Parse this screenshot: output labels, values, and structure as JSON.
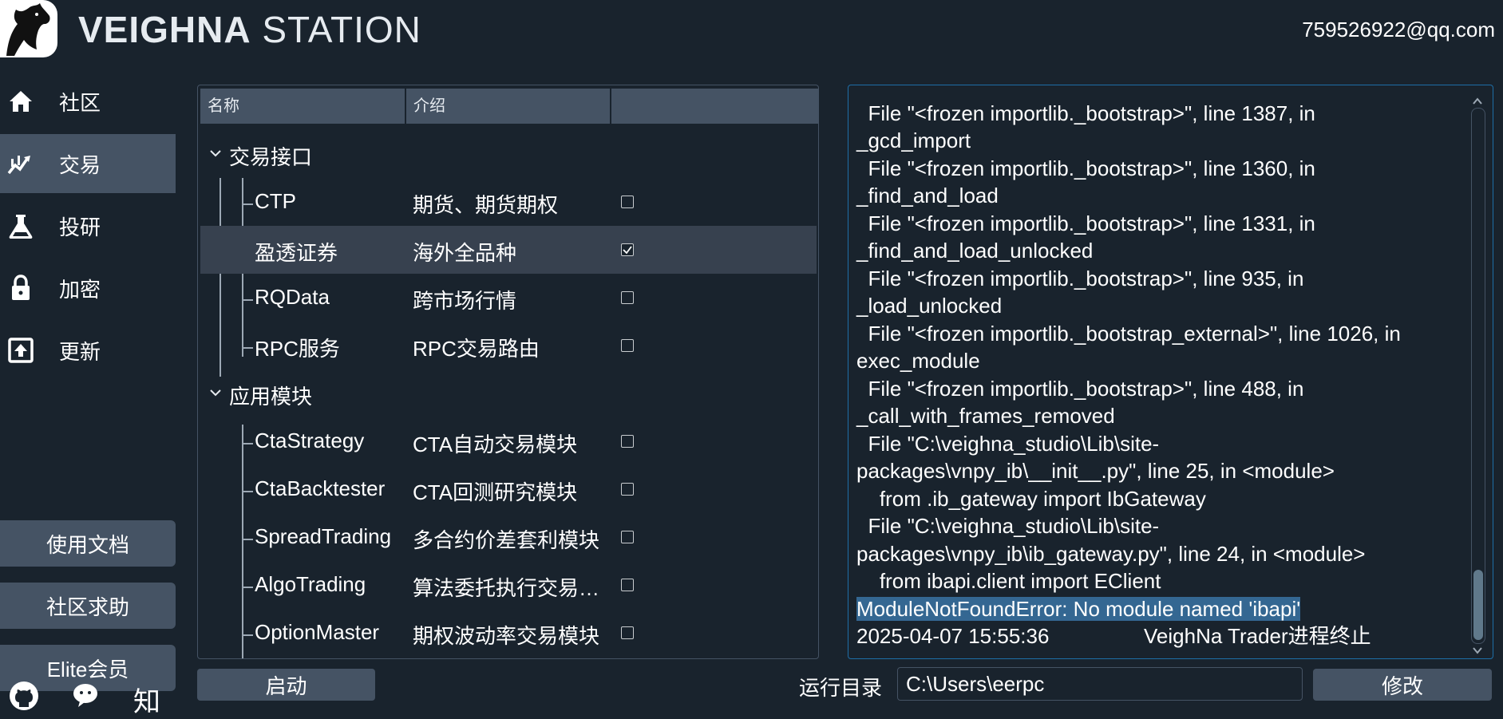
{
  "header": {
    "logo_icon": "horse-logo-icon",
    "title_bold": "VEIGHNA",
    "title_light": "STATION",
    "user_email": "759526922@qq.com"
  },
  "sidebar": {
    "items": [
      {
        "label": "社区",
        "icon": "home-icon"
      },
      {
        "label": "交易",
        "icon": "trade-chart-icon",
        "active": true
      },
      {
        "label": "投研",
        "icon": "flask-icon"
      },
      {
        "label": "加密",
        "icon": "lock-icon"
      },
      {
        "label": "更新",
        "icon": "upload-box-icon"
      }
    ],
    "buttons": {
      "docs": "使用文档",
      "help": "社区求助",
      "elite": "Elite会员"
    },
    "social": {
      "github_icon": "github-icon",
      "wechat_icon": "wechat-icon",
      "zhihu": "知"
    }
  },
  "tree": {
    "columns": [
      "名称",
      "介绍",
      ""
    ],
    "groups": [
      {
        "label": "交易接口",
        "items": [
          {
            "name": "CTP",
            "desc": "期货、期货期权",
            "checked": false
          },
          {
            "name": "盈透证券",
            "desc": "海外全品种",
            "checked": true
          },
          {
            "name": "RQData",
            "desc": "跨市场行情",
            "checked": false
          },
          {
            "name": "RPC服务",
            "desc": "RPC交易路由",
            "checked": false
          }
        ]
      },
      {
        "label": "应用模块",
        "items": [
          {
            "name": "CtaStrategy",
            "desc": "CTA自动交易模块",
            "checked": false
          },
          {
            "name": "CtaBacktester",
            "desc": "CTA回测研究模块",
            "checked": false
          },
          {
            "name": "SpreadTrading",
            "desc": "多合约价差套利模块",
            "checked": false
          },
          {
            "name": "AlgoTrading",
            "desc": "算法委托执行交易…",
            "checked": false
          },
          {
            "name": "OptionMaster",
            "desc": "期权波动率交易模块",
            "checked": false
          }
        ]
      }
    ]
  },
  "log": {
    "lines": [
      "  File \"<frozen importlib._bootstrap>\", line 1387, in",
      "_gcd_import",
      "  File \"<frozen importlib._bootstrap>\", line 1360, in",
      "_find_and_load",
      "  File \"<frozen importlib._bootstrap>\", line 1331, in",
      "_find_and_load_unlocked",
      "  File \"<frozen importlib._bootstrap>\", line 935, in",
      "_load_unlocked",
      "  File \"<frozen importlib._bootstrap_external>\", line 1026, in",
      "exec_module",
      "  File \"<frozen importlib._bootstrap>\", line 488, in",
      "_call_with_frames_removed",
      "  File \"C:\\veighna_studio\\Lib\\site-",
      "packages\\vnpy_ib\\__init__.py\", line 25, in <module>",
      "    from .ib_gateway import IbGateway",
      "  File \"C:\\veighna_studio\\Lib\\site-",
      "packages\\vnpy_ib\\ib_gateway.py\", line 24, in <module>",
      "    from ibapi.client import EClient"
    ],
    "error_line": "ModuleNotFoundError: No module named 'ibapi'",
    "end_time": "2025-04-07 15:55:36",
    "end_msg": "VeighNa Trader进程终止"
  },
  "bottom": {
    "start_label": "启动",
    "dir_label": "运行目录",
    "dir_value": "C:\\Users\\eerpc",
    "modify_label": "修改"
  }
}
